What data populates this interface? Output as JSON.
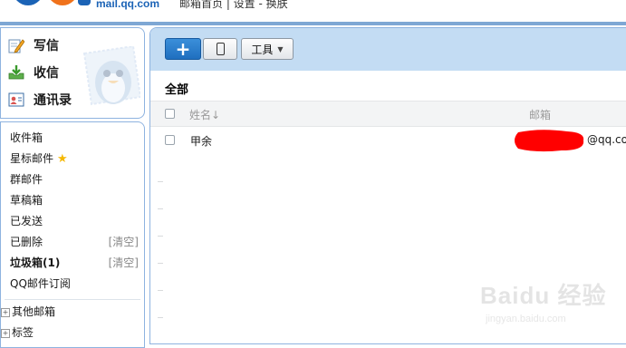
{
  "header": {
    "logo_url": "mail.qq.com",
    "top_links": "邮箱首页 | 设置 - 换肤",
    "logo_colors": [
      "#1b63b6",
      "#f0721b"
    ]
  },
  "sidebar": {
    "quick_actions": [
      {
        "label": "写信",
        "icon": "pencil-paper-icon"
      },
      {
        "label": "收信",
        "icon": "inbox-download-icon"
      },
      {
        "label": "通讯录",
        "icon": "address-book-icon"
      }
    ],
    "folders": [
      {
        "label": "收件箱"
      },
      {
        "label": "星标邮件",
        "icon": "star-icon"
      },
      {
        "label": "群邮件"
      },
      {
        "label": "草稿箱"
      },
      {
        "label": "已发送"
      },
      {
        "label": "已删除",
        "action": "[清空]"
      },
      {
        "label": "垃圾箱(1)",
        "action": "[清空]"
      },
      {
        "label": "QQ邮件订阅"
      }
    ],
    "trees": [
      {
        "label": "其他邮箱"
      },
      {
        "label": "标签"
      }
    ]
  },
  "main": {
    "toolbar": {
      "new_icon": "plus-icon",
      "phone_icon": "mobile-phone-icon",
      "tools_label": "工具"
    },
    "title": "全部",
    "columns": {
      "name": "姓名↓",
      "email": "邮箱"
    },
    "rows": [
      {
        "name": "甲余",
        "email": "@qq.co"
      }
    ]
  },
  "watermark": {
    "brand": "Baidu 经验",
    "url": "jingyan.baidu.com"
  },
  "colors": {
    "accent_blue": "#1f6fbf",
    "toolbar_bg": "#c3dcf3",
    "border_blue": "#8eb3e0",
    "star": "#f5b800",
    "redaction": "#ff0000"
  }
}
